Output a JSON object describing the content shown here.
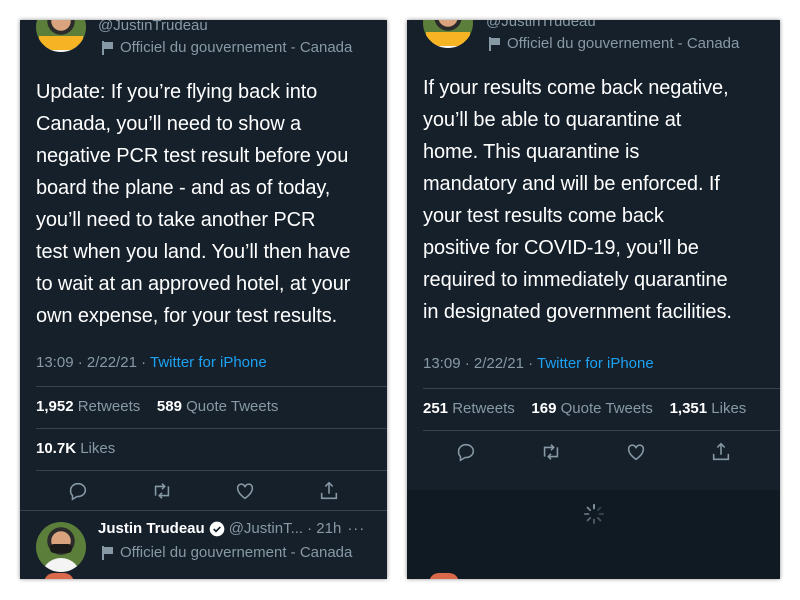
{
  "left": {
    "handle_top": "@JustinTrudeau",
    "gov_label": "Officiel du gouvernement - Canada",
    "tweet_text": "Update: If you’re flying back into\nCanada, you’ll need to show a\nnegative PCR test result before you\nboard the plane - and as of today,\nyou’ll need to take another PCR\ntest when you land. You’ll then have\nto wait at an approved hotel, at your\nown expense, for your test results.",
    "timestamp": "13:09 · 2/22/21 · ",
    "source": "Twitter for iPhone",
    "retweets_count": "1,952",
    "retweets_label": "Retweets",
    "quotes_count": "589",
    "quotes_label": "Quote Tweets",
    "likes_count": "10.7K",
    "likes_label": "Likes",
    "next_author": {
      "name": "Justin Trudeau",
      "handle": "@JustinT...",
      "time": "· 21h",
      "more": "···",
      "gov_label": "Officiel du gouvernement - Canada"
    }
  },
  "right": {
    "handle_top": "@JustinTrudeau",
    "gov_label": "Officiel du gouvernement - Canada",
    "tweet_text": "If your results come back negative,\nyou’ll be able to quarantine at\nhome. This quarantine is\nmandatory and will be enforced. If\nyour test results come back\npositive for COVID-19, you’ll be\nrequired to immediately quarantine\nin designated government facilities.",
    "timestamp": "13:09 · 2/22/21 · ",
    "source": "Twitter for iPhone",
    "retweets_count": "251",
    "retweets_label": "Retweets",
    "quotes_count": "169",
    "quotes_label": "Quote Tweets",
    "likes_count": "1,351",
    "likes_label": "Likes"
  },
  "colors": {
    "background": "#15202b",
    "text": "#ffffff",
    "muted": "#8899a6",
    "link": "#1da1f2",
    "divider": "#38444d"
  },
  "icons": [
    "reply-icon",
    "retweet-icon",
    "like-icon",
    "share-icon",
    "flag-icon",
    "verified-icon",
    "loading-spinner-icon"
  ]
}
